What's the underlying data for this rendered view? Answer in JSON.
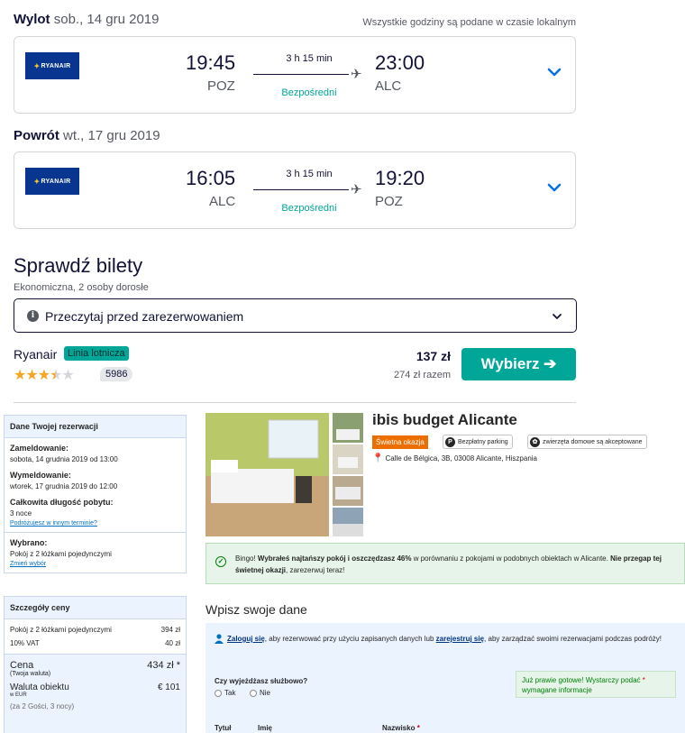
{
  "outbound": {
    "label": "Wylot",
    "date": "sob., 14 gru 2019",
    "tz_note": "Wszystkie godziny są podane w czasie lokalnym",
    "airline": "RYANAIR",
    "dep_time": "19:45",
    "dep_code": "POZ",
    "arr_time": "23:00",
    "arr_code": "ALC",
    "duration": "3 h 15 min",
    "stops": "Bezpośredni"
  },
  "return": {
    "label": "Powrót",
    "date": "wt., 17 gru 2019",
    "airline": "RYANAIR",
    "dep_time": "16:05",
    "dep_code": "ALC",
    "arr_time": "19:20",
    "arr_code": "POZ",
    "duration": "3 h 15 min",
    "stops": "Bezpośredni"
  },
  "tickets": {
    "title": "Sprawdź bilety",
    "subtitle": "Ekonomiczna, 2 osoby dorosłe",
    "read_before": "Przeczytaj przed zarezerwowaniem",
    "provider": "Ryanair",
    "provider_badge": "Linia lotnicza",
    "rating_stars": 3.5,
    "reviews": "5986",
    "price": "137 zł",
    "price_total": "274 zł razem",
    "select_label": "Wybierz"
  },
  "reservation": {
    "header": "Dane Twojej rezerwacji",
    "checkin_label": "Zameldowanie:",
    "checkin_value": "sobota, 14 grudnia 2019 od 13:00",
    "checkout_label": "Wymeldowanie:",
    "checkout_value": "wtorek, 17 grudnia 2019 do 12:00",
    "stay_label": "Całkowita długość pobytu:",
    "stay_value": "3 noce",
    "other_dates_link": "Podróżujesz w innym terminie?",
    "chosen_label": "Wybrano:",
    "chosen_value": "Pokój z 2 łóżkami pojedynczymi",
    "change_link": "Zmień wybór"
  },
  "price_details": {
    "header": "Szczegóły ceny",
    "rows": [
      {
        "label": "Pokój z 2 łóżkami pojedynczymi",
        "value": "394 zł"
      },
      {
        "label": "10% VAT",
        "value": "40 zł"
      }
    ],
    "total_label": "Cena",
    "total_sub": "(Twoja waluta)",
    "total_value": "434 zł *",
    "local_label": "Waluta obiektu",
    "local_sub": "w EUR",
    "local_value": "€ 101",
    "guests_note": "(za 2 Gości, 3 nocy)"
  },
  "hotel": {
    "name": "ibis budget Alicante",
    "deal_badge": "Świetna okazja",
    "amenity_parking": "Bezpłatny parking",
    "amenity_pets": "zwierzęta domowe są akceptowane",
    "address": "Calle de Bélgica, 3B, 03008 Alicante, Hiszpania"
  },
  "bingo": {
    "prefix": "Bingo! ",
    "bold1": "Wybrałeś najtańszy pokój i oszczędzasz 46%",
    "mid": " w porównaniu z pokojami w podobnych obiektach w Alicante. ",
    "bold2": "Nie przegap tej świetnej okazji",
    "suffix": ", zarezerwuj teraz!"
  },
  "form": {
    "title": "Wpisz swoje dane",
    "login_link": "Zaloguj się",
    "login_mid": ", aby rezerwować przy użyciu zapisanych danych lub ",
    "register_link": "zarejestruj się",
    "login_suffix": ", aby zarządzać swoimi rezerwacjami podczas podróży!",
    "almost_done": "Już prawie gotowe! Wystarczy podać",
    "almost_done_2": "wymagane informacje",
    "business_question": "Czy wyjeżdżasz służbowo?",
    "yes": "Tak",
    "no": "Nie",
    "col_title": "Tytuł",
    "col_first": "Imię",
    "col_last": "Nazwisko"
  },
  "colors": {
    "accent": "#00a698",
    "ryanair_blue": "#073590",
    "booking_blue": "#0071c2",
    "deal_orange": "#ec6d00"
  }
}
